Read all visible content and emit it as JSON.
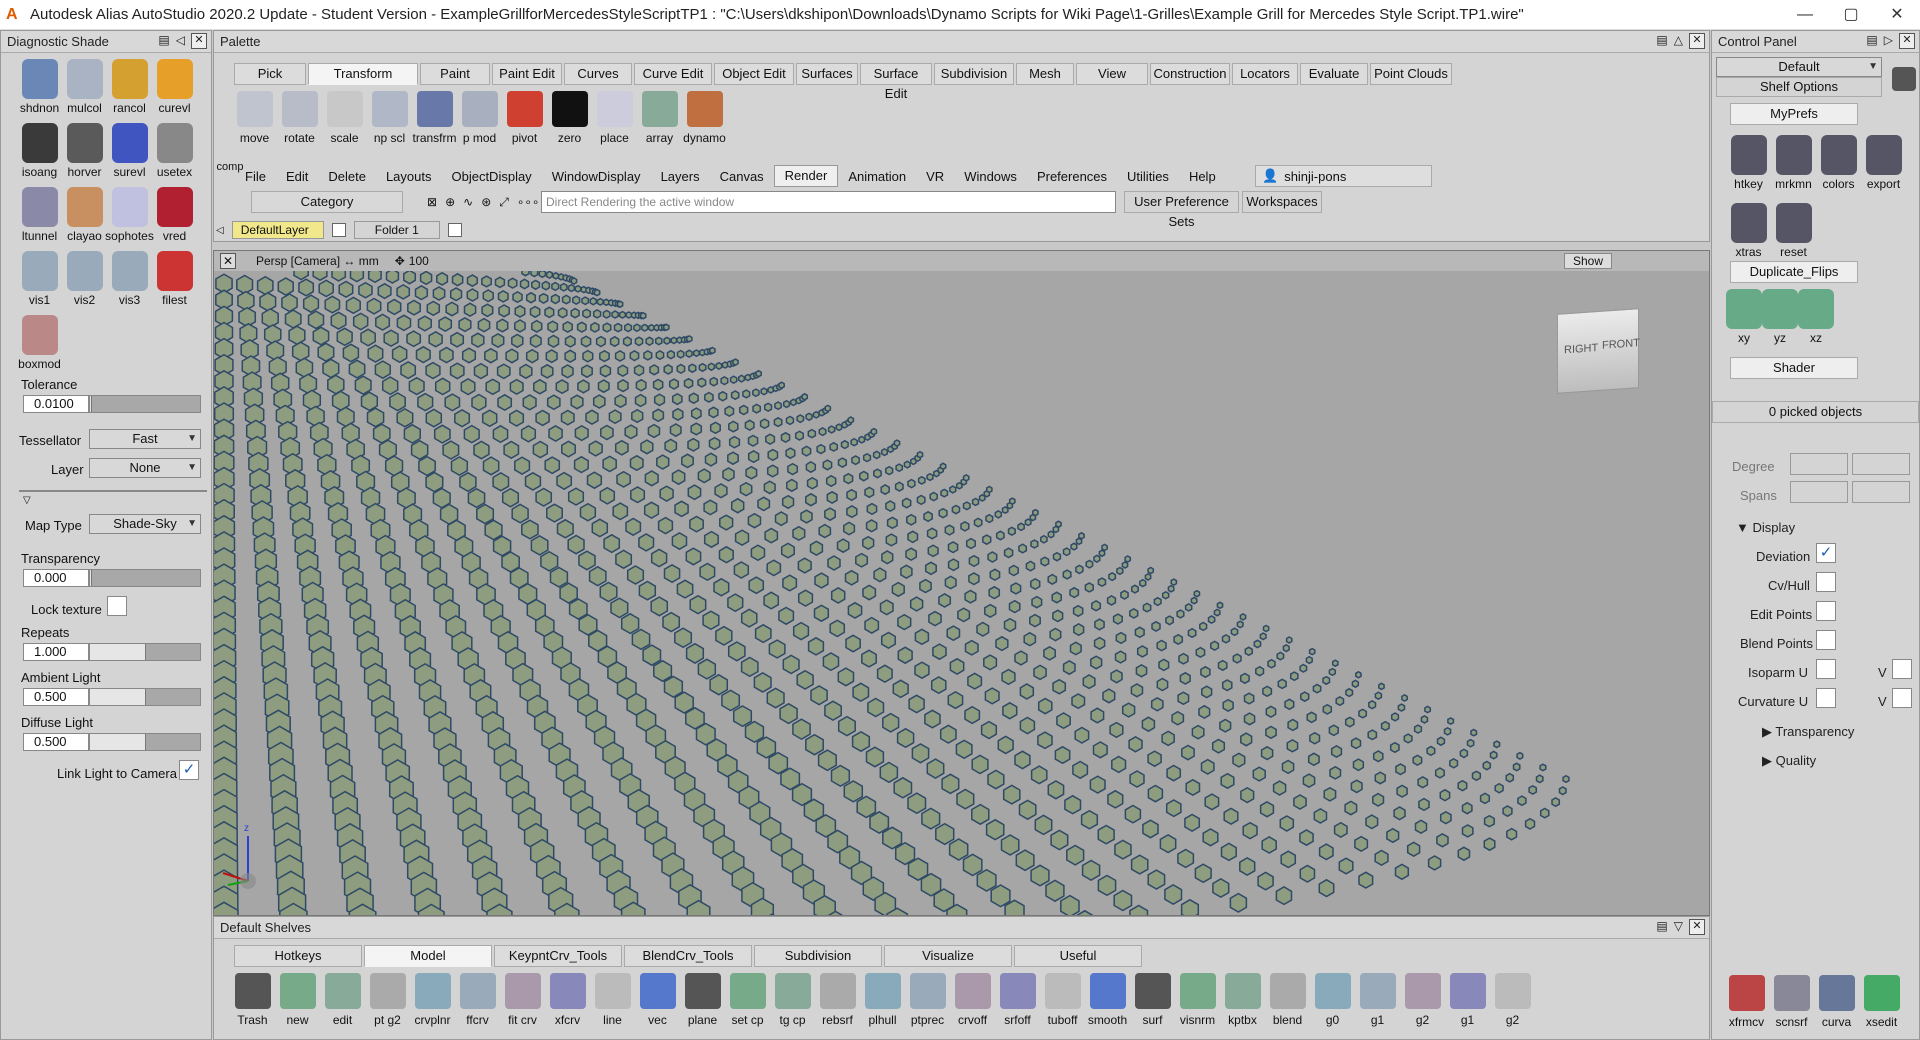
{
  "window": {
    "title": "Autodesk Alias AutoStudio 2020.2 Update - Student Version   - ExampleGrillforMercedesStyleScriptTP1 : \"C:\\Users\\dkshipon\\Downloads\\Dynamo Scripts for Wiki Page\\1-Grilles\\Example Grill for Mercedes Style Script.TP1.wire\""
  },
  "diag": {
    "title": "Diagnostic Shade",
    "icons": [
      "shdnon",
      "mulcol",
      "rancol",
      "curevl",
      "isoang",
      "horver",
      "surevl",
      "usetex",
      "ltunnel",
      "clayao",
      "sophotes",
      "vred",
      "vis1",
      "vis2",
      "vis3",
      "filest",
      "boxmod"
    ],
    "tolerance_label": "Tolerance",
    "tolerance": "0.0100",
    "tessellator_label": "Tessellator",
    "tessellator": "Fast",
    "layer_label": "Layer",
    "layer": "None",
    "maptype_label": "Map Type",
    "maptype": "Shade-Sky",
    "transparency_label": "Transparency",
    "transparency": "0.000",
    "locktexture_label": "Lock texture",
    "repeats_label": "Repeats",
    "repeats": "1.000",
    "ambient_label": "Ambient Light",
    "ambient": "0.500",
    "diffuse_label": "Diffuse Light",
    "diffuse": "0.500",
    "linklight_label": "Link Light to Camera"
  },
  "palette": {
    "title": "Palette",
    "tabs": [
      "Pick",
      "Transform",
      "Paint",
      "Paint Edit",
      "Curves",
      "Curve Edit",
      "Object Edit",
      "Surfaces",
      "Surface Edit",
      "Subdivision",
      "Mesh",
      "View",
      "Construction",
      "Locators",
      "Evaluate",
      "Point Clouds"
    ],
    "tools": [
      "move",
      "rotate",
      "scale",
      "np scl",
      "transfrm",
      "p mod",
      "pivot",
      "zero",
      "place",
      "array",
      "dynamo"
    ],
    "comp": "comp"
  },
  "menu": [
    "File",
    "Edit",
    "Delete",
    "Layouts",
    "ObjectDisplay",
    "WindowDisplay",
    "Layers",
    "Canvas",
    "Render",
    "Animation",
    "VR",
    "Windows",
    "Preferences",
    "Utilities",
    "Help"
  ],
  "user": "shinji-pons",
  "category": "Category",
  "hint": "Direct Rendering the active window",
  "prefsets": "User Preference Sets",
  "workspaces": "Workspaces",
  "layers": {
    "default": "DefaultLayer",
    "folder": "Folder 1"
  },
  "viewport": {
    "label": "Persp [Camera] ↔ mm",
    "grid": "100",
    "show": "Show",
    "cube_right": "RIGHT",
    "cube_front": "FRONT"
  },
  "shelves": {
    "title": "Default Shelves",
    "tabs": [
      "Hotkeys",
      "Model",
      "KeypntCrv_Tools",
      "BlendCrv_Tools",
      "Subdivision",
      "Visualize",
      "Useful"
    ],
    "tools": [
      "Trash",
      "new",
      "edit",
      "pt g2",
      "crvplnr",
      "ffcrv",
      "fit crv",
      "xfcrv",
      "line",
      "vec",
      "plane",
      "set cp",
      "tg cp",
      "rebsrf",
      "plhull",
      "ptprec",
      "crvoff",
      "srfoff",
      "tuboff",
      "smooth",
      "surf",
      "visnrm",
      "kptbx",
      "blend",
      "g0",
      "g1",
      "g2",
      "g1",
      "g2"
    ]
  },
  "ctrl": {
    "title": "Control Panel",
    "preset": "Default",
    "shelf_options": "Shelf Options",
    "myprefs": "MyPrefs",
    "myprefs_icons": [
      "htkey",
      "mrkmn",
      "colors",
      "export",
      "xtras",
      "reset"
    ],
    "dupflips": "Duplicate_Flips",
    "dup_icons": [
      "xy",
      "yz",
      "xz"
    ],
    "shader": "Shader",
    "picked": "0 picked objects",
    "degree": "Degree",
    "spans": "Spans",
    "display": "Display",
    "deviation": "Deviation",
    "cvhull": "Cv/Hull",
    "editpoints": "Edit Points",
    "blendpoints": "Blend Points",
    "isoparm": "Isoparm U",
    "curvature": "Curvature U",
    "v": "V",
    "transparency": "Transparency",
    "quality": "Quality",
    "bottom_icons": [
      "xfrmcv",
      "scnsrf",
      "curva",
      "xsedit"
    ]
  },
  "colors": {
    "bolt_fill": "#8e9c80",
    "bolt_edge": "#2f4a66",
    "viewport": "#a6a6a6"
  }
}
